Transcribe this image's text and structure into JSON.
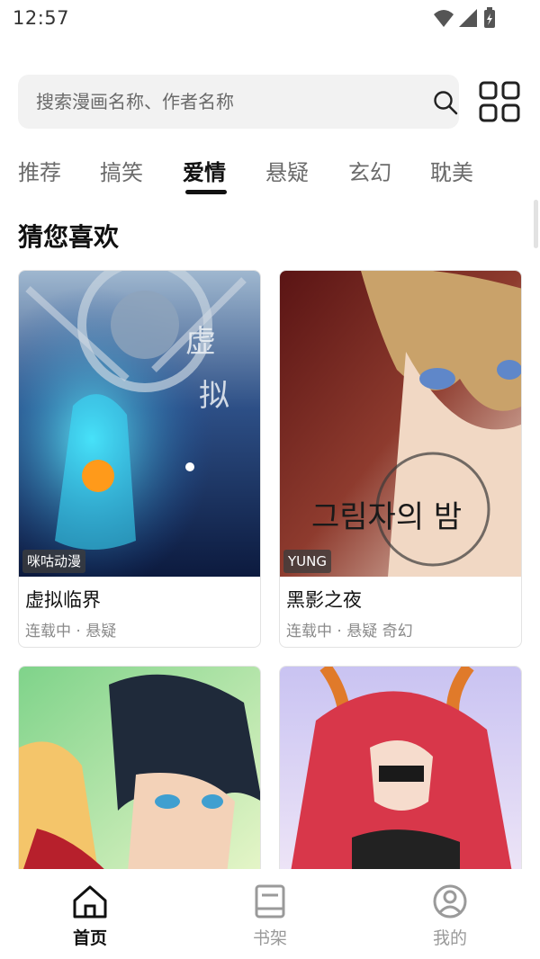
{
  "status_bar": {
    "time": "12:57"
  },
  "search": {
    "placeholder": "搜索漫画名称、作者名称"
  },
  "tabs": [
    {
      "label": "推荐"
    },
    {
      "label": "搞笑"
    },
    {
      "label": "爱情",
      "active": true
    },
    {
      "label": "悬疑"
    },
    {
      "label": "玄幻"
    },
    {
      "label": "耽美"
    }
  ],
  "section": {
    "title": "猜您喜欢"
  },
  "cards": [
    {
      "badge": "咪咕动漫",
      "title": "虚拟临界",
      "meta": "连载中 · 悬疑"
    },
    {
      "badge": "YUNG",
      "title": "黑影之夜",
      "meta": "连载中 · 悬疑 奇幻"
    },
    {
      "badge": "",
      "title": "",
      "meta": ""
    },
    {
      "badge": "",
      "title": "",
      "meta": ""
    }
  ],
  "bottom_nav": [
    {
      "label": "首页",
      "icon": "home-icon",
      "active": true
    },
    {
      "label": "书架",
      "icon": "bookshelf-icon"
    },
    {
      "label": "我的",
      "icon": "profile-icon"
    }
  ],
  "colors": {
    "text_primary": "#111111",
    "text_secondary": "#8a8a8a",
    "search_bg": "#f2f2f2",
    "badge_bg": "#3c3c3c"
  }
}
